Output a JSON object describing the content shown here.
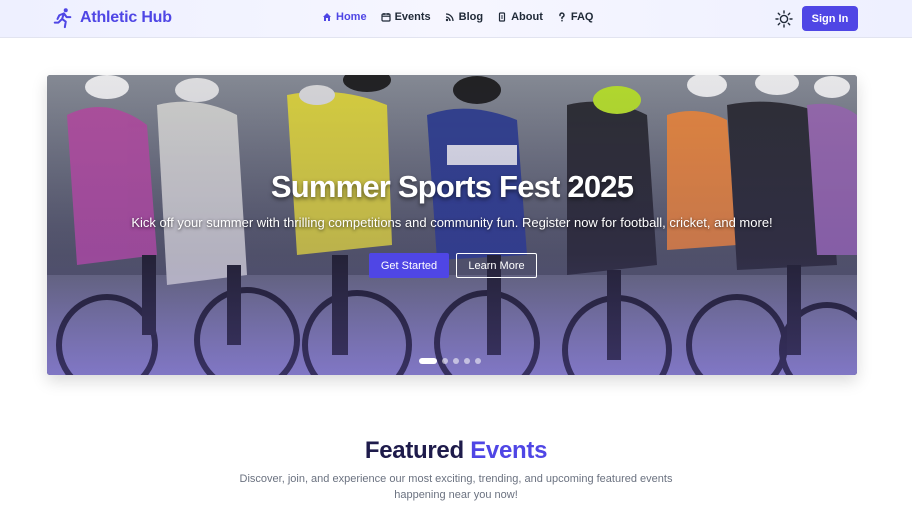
{
  "brand": {
    "name": "Athletic Hub",
    "icon": "running-person-icon",
    "color": "#4f46e5"
  },
  "nav": {
    "items": [
      {
        "label": "Home",
        "icon": "home-icon",
        "active": true
      },
      {
        "label": "Events",
        "icon": "calendar-icon",
        "active": false
      },
      {
        "label": "Blog",
        "icon": "rss-icon",
        "active": false
      },
      {
        "label": "About",
        "icon": "info-icon",
        "active": false
      },
      {
        "label": "FAQ",
        "icon": "question-icon",
        "active": false
      }
    ],
    "theme_toggle_icon": "sun-icon",
    "signin_label": "Sign In"
  },
  "hero": {
    "title": "Summer Sports Fest 2025",
    "subtitle": "Kick off your summer with thrilling competitions and community fun. Register now for football, cricket, and more!",
    "primary_cta": "Get Started",
    "secondary_cta": "Learn More",
    "slide_count": 5,
    "active_slide": 1
  },
  "featured": {
    "title_main": "Featured",
    "title_accent": "Events",
    "description": "Discover, join, and experience our most exciting, trending, and upcoming featured events happening near you now!"
  },
  "colors": {
    "accent": "#4f46e5",
    "heading": "#1e1b4b",
    "muted": "#6b7280"
  }
}
